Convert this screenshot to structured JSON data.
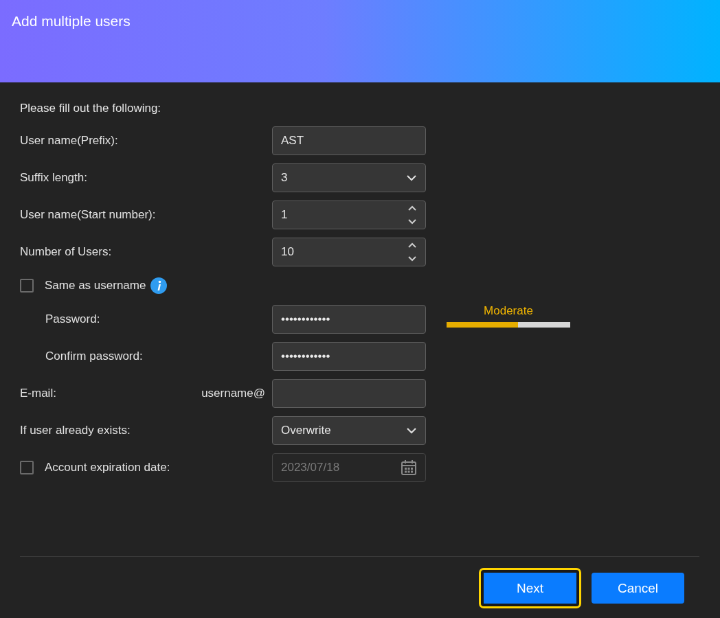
{
  "window": {
    "title": "Add multiple users"
  },
  "intro": "Please fill out the following:",
  "rows": [
    {
      "kind": "text",
      "label": "User name(Prefix):",
      "value": "AST"
    },
    {
      "kind": "select",
      "label": "Suffix length:",
      "value": "3"
    },
    {
      "kind": "spinner",
      "label": "User name(Start number):",
      "value": "1"
    },
    {
      "kind": "spinner",
      "label": "Number of Users:",
      "value": "10"
    },
    {
      "kind": "checkbox",
      "label": "Same as username",
      "checked": false
    },
    {
      "kind": "password",
      "label": "Password:",
      "value": "••••••••••••",
      "strength": {
        "label": "Moderate",
        "level": 0.58
      }
    },
    {
      "kind": "password",
      "label": "Confirm password:",
      "value": "••••••••••••"
    },
    {
      "kind": "email",
      "label": "E-mail:",
      "prefix": "username@"
    },
    {
      "kind": "select",
      "label": "If user already exists:",
      "value": "Overwrite"
    },
    {
      "kind": "date",
      "label": "Account expiration date:",
      "checked": false,
      "value": "2023/07/18",
      "disabled": true
    }
  ],
  "buttons": [
    {
      "label": "Next",
      "focused": true
    },
    {
      "label": "Cancel",
      "focused": false
    }
  ]
}
